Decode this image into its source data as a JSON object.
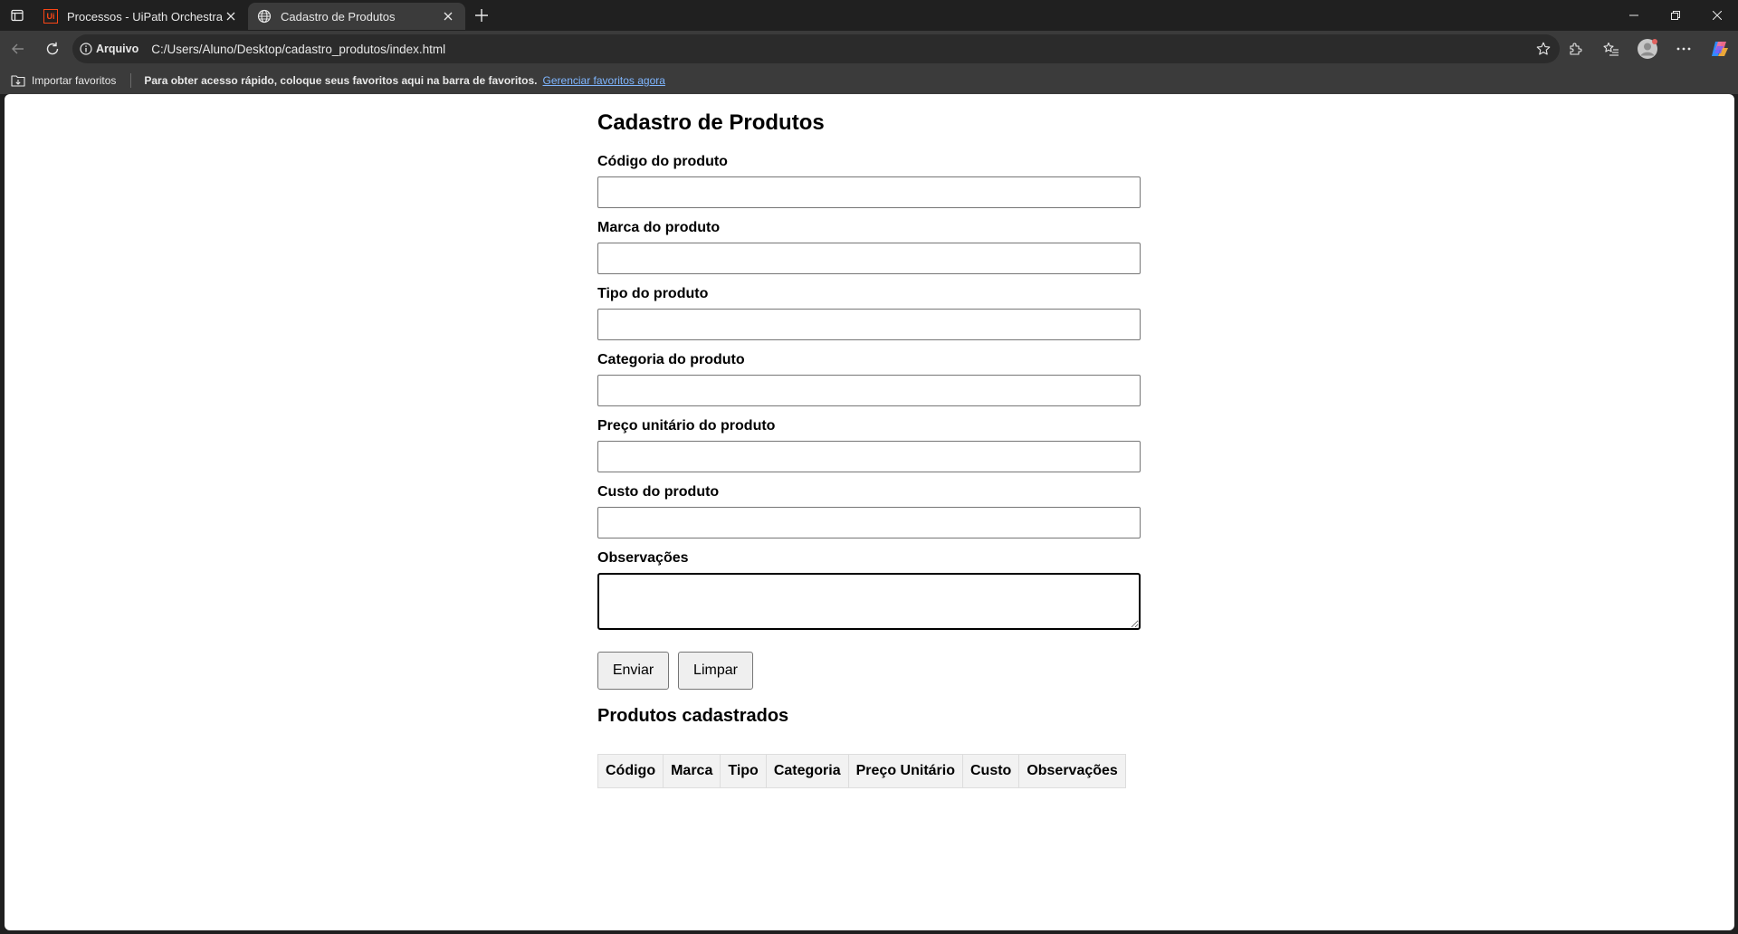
{
  "browser": {
    "tabs": [
      {
        "title": "Processos - UiPath Orchestrator",
        "favicon": "uipath-favicon",
        "favicon_text": "Ui",
        "active": false
      },
      {
        "title": "Cadastro de Produtos",
        "favicon": "globe-icon",
        "active": true
      }
    ],
    "address": {
      "site_info_label": "Arquivo",
      "url": "C:/Users/Aluno/Desktop/cadastro_produtos/index.html"
    },
    "favorites_bar": {
      "import_label": "Importar favoritos",
      "message": "Para obter acesso rápido, coloque seus favoritos aqui na barra de favoritos.",
      "manage_link": "Gerenciar favoritos agora"
    },
    "colors": {
      "chrome_dark": "#202020",
      "chrome_toolbar": "#3b3b3b",
      "link": "#7fb6ff",
      "uipath_orange": "#fa4616"
    }
  },
  "page": {
    "title": "Cadastro de Produtos",
    "fields": [
      {
        "label": "Código do produto",
        "value": ""
      },
      {
        "label": "Marca do produto",
        "value": ""
      },
      {
        "label": "Tipo do produto",
        "value": ""
      },
      {
        "label": "Categoria do produto",
        "value": ""
      },
      {
        "label": "Preço unitário do produto",
        "value": ""
      },
      {
        "label": "Custo do produto",
        "value": ""
      }
    ],
    "notes": {
      "label": "Observações",
      "value": ""
    },
    "buttons": {
      "submit": "Enviar",
      "clear": "Limpar"
    },
    "products_section": {
      "title": "Produtos cadastrados",
      "columns": [
        "Código",
        "Marca",
        "Tipo",
        "Categoria",
        "Preço Unitário",
        "Custo",
        "Observações"
      ],
      "rows": []
    }
  }
}
